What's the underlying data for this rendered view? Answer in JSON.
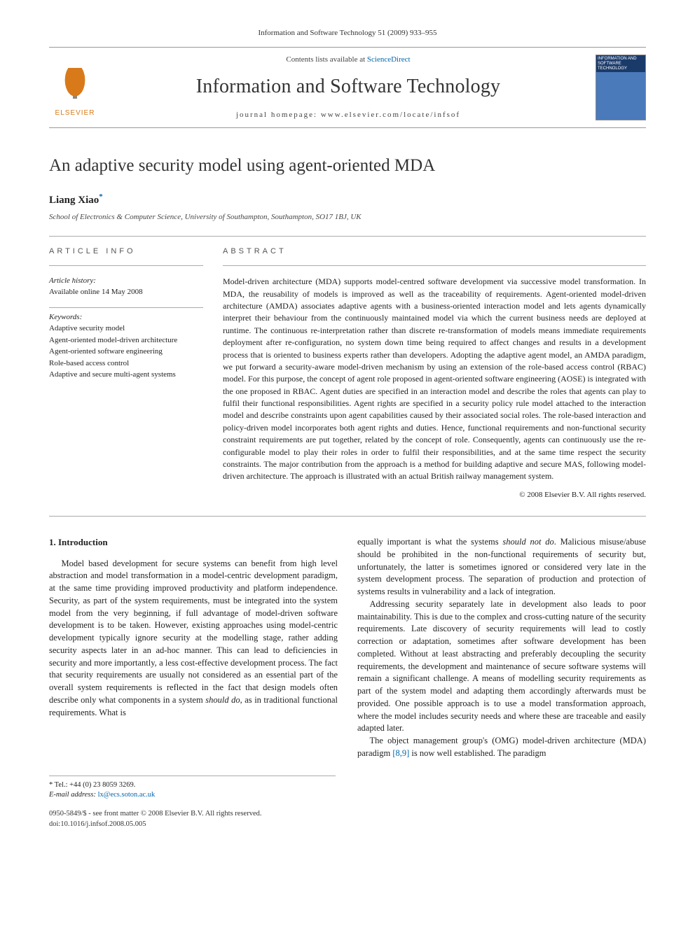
{
  "header": {
    "page_ref": "Information and Software Technology 51 (2009) 933–955",
    "publisher_logo_text": "ELSEVIER",
    "contents_line_prefix": "Contents lists available at ",
    "contents_link": "ScienceDirect",
    "journal_name": "Information and Software Technology",
    "homepage_prefix": "journal homepage: ",
    "homepage": "www.elsevier.com/locate/infsof",
    "cover_caption": "INFORMATION AND SOFTWARE TECHNOLOGY"
  },
  "article": {
    "title": "An adaptive security model using agent-oriented MDA",
    "author": "Liang Xiao",
    "author_marker": "*",
    "affiliation": "School of Electronics & Computer Science, University of Southampton, Southampton, SO17 1BJ, UK"
  },
  "info": {
    "section_label": "ARTICLE INFO",
    "history_label": "Article history:",
    "history_text": "Available online 14 May 2008",
    "keywords_label": "Keywords:",
    "keywords": [
      "Adaptive security model",
      "Agent-oriented model-driven architecture",
      "Agent-oriented software engineering",
      "Role-based access control",
      "Adaptive and secure multi-agent systems"
    ]
  },
  "abstract": {
    "section_label": "ABSTRACT",
    "text": "Model-driven architecture (MDA) supports model-centred software development via successive model transformation. In MDA, the reusability of models is improved as well as the traceability of requirements. Agent-oriented model-driven architecture (AMDA) associates adaptive agents with a business-oriented interaction model and lets agents dynamically interpret their behaviour from the continuously maintained model via which the current business needs are deployed at runtime. The continuous re-interpretation rather than discrete re-transformation of models means immediate requirements deployment after re-configuration, no system down time being required to affect changes and results in a development process that is oriented to business experts rather than developers. Adopting the adaptive agent model, an AMDA paradigm, we put forward a security-aware model-driven mechanism by using an extension of the role-based access control (RBAC) model. For this purpose, the concept of agent role proposed in agent-oriented software engineering (AOSE) is integrated with the one proposed in RBAC. Agent duties are specified in an interaction model and describe the roles that agents can play to fulfil their functional responsibilities. Agent rights are specified in a security policy rule model attached to the interaction model and describe constraints upon agent capabilities caused by their associated social roles. The role-based interaction and policy-driven model incorporates both agent rights and duties. Hence, functional requirements and non-functional security constraint requirements are put together, related by the concept of role. Consequently, agents can continuously use the re-configurable model to play their roles in order to fulfil their responsibilities, and at the same time respect the security constraints. The major contribution from the approach is a method for building adaptive and secure MAS, following model-driven architecture. The approach is illustrated with an actual British railway management system.",
    "copyright": "© 2008 Elsevier B.V. All rights reserved."
  },
  "body": {
    "section_number": "1.",
    "section_title": "Introduction",
    "col1_p1": "Model based development for secure systems can benefit from high level abstraction and model transformation in a model-centric development paradigm, at the same time providing improved productivity and platform independence. Security, as part of the system requirements, must be integrated into the system model from the very beginning, if full advantage of model-driven software development is to be taken. However, existing approaches using model-centric development typically ignore security at the modelling stage, rather adding security aspects later in an ad-hoc manner. This can lead to deficiencies in security and more importantly, a less cost-effective development process. The fact that security requirements are usually not considered as an essential part of the overall system requirements is reflected in the fact that design models often describe only what components in a system ",
    "col1_em1": "should do",
    "col1_p1b": ", as in traditional functional requirements. What is",
    "col2_p1a": "equally important is what the systems ",
    "col2_em1": "should not do",
    "col2_p1b": ". Malicious misuse/abuse should be prohibited in the non-functional requirements of security but, unfortunately, the latter is sometimes ignored or considered very late in the system development process. The separation of production and protection of systems results in vulnerability and a lack of integration.",
    "col2_p2": "Addressing security separately late in development also leads to poor maintainability. This is due to the complex and cross-cutting nature of the security requirements. Late discovery of security requirements will lead to costly correction or adaptation, sometimes after software development has been completed. Without at least abstracting and preferably decoupling the security requirements, the development and maintenance of secure software systems will remain a significant challenge. A means of modelling security requirements as part of the system model and adapting them accordingly afterwards must be provided. One possible approach is to use a model transformation approach, where the model includes security needs and where these are traceable and easily adapted later.",
    "col2_p3a": "The object management group's (OMG) model-driven architecture (MDA) paradigm ",
    "col2_ref": "[8,9]",
    "col2_p3b": " is now well established. The paradigm"
  },
  "footnotes": {
    "tel_label": "* Tel.: ",
    "tel": "+44 (0) 23 8059 3269.",
    "email_label": "E-mail address: ",
    "email": "lx@ecs.soton.ac.uk"
  },
  "footer": {
    "line1": "0950-5849/$ - see front matter © 2008 Elsevier B.V. All rights reserved.",
    "line2": "doi:10.1016/j.infsof.2008.05.005"
  }
}
